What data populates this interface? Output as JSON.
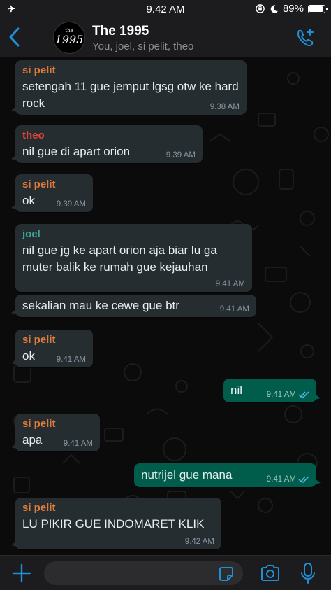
{
  "status_bar": {
    "time": "9.42 AM",
    "battery": "89%",
    "battery_fraction": 0.89
  },
  "header": {
    "title": "The 1995",
    "subtitle": "You, joel, si pelit, theo",
    "avatar_top": "the",
    "avatar_num": "1995"
  },
  "colors": {
    "accent": "#1f8fd6",
    "sender_orange": "#e07b39",
    "sender_red": "#e0433a",
    "sender_teal": "#3aa597",
    "outgoing_bubble": "#005c4b",
    "incoming_bubble": "#262d31"
  },
  "messages": [
    {
      "sender": "si pelit",
      "text": "setengah 11 gue jemput lgsg otw ke hard rock",
      "time": "9.38 AM"
    },
    {
      "sender": "theo",
      "text": "nil gue di apart orion",
      "time": "9.39 AM"
    },
    {
      "sender": "si pelit",
      "text": "ok",
      "time": "9.39 AM"
    },
    {
      "sender": "joel",
      "text": "nil gue jg ke apart orion aja biar lu ga muter balik ke rumah gue kejauhan",
      "time": "9.41 AM"
    },
    {
      "text": "sekalian mau ke cewe gue btr",
      "time": "9.41 AM"
    },
    {
      "sender": "si pelit",
      "text": "ok",
      "time": "9.41 AM"
    },
    {
      "text": "nil",
      "time": "9.41 AM",
      "status": "read"
    },
    {
      "sender": "si pelit",
      "text": "apa",
      "time": "9.41 AM"
    },
    {
      "text": "nutrijel gue mana",
      "time": "9.41 AM",
      "status": "read"
    },
    {
      "sender": "si pelit",
      "text": "LU PIKIR GUE INDOMARET KLIK",
      "time": "9.42 AM"
    }
  ],
  "input": {
    "placeholder": ""
  },
  "icons": [
    "airplane-icon",
    "lock-rotation-icon",
    "moon-icon",
    "battery-icon",
    "back-icon",
    "add-call-icon",
    "plus-icon",
    "sticker-icon",
    "camera-icon",
    "microphone-icon",
    "double-check-icon"
  ]
}
